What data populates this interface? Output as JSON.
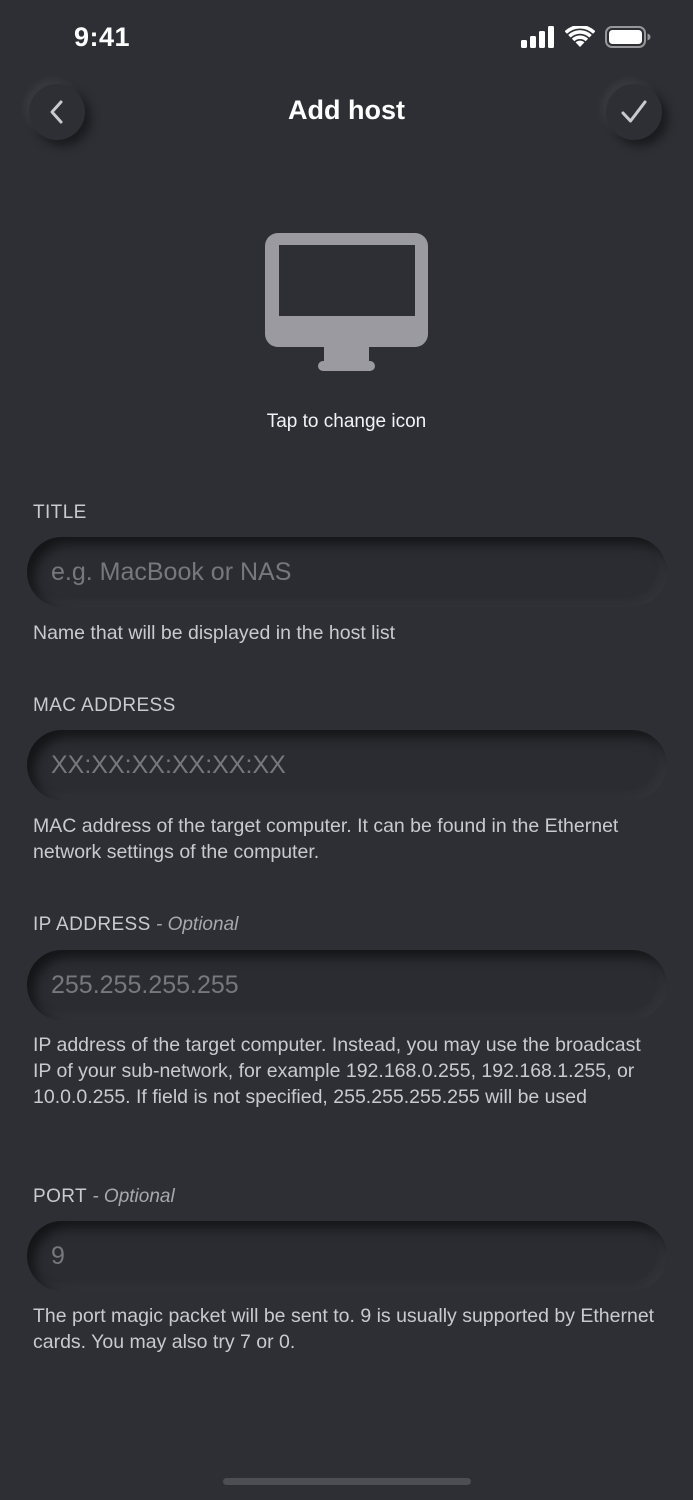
{
  "status_bar": {
    "time": "9:41",
    "icons": [
      "cellular-signal-icon",
      "wifi-icon",
      "battery-icon"
    ]
  },
  "nav": {
    "title": "Add host",
    "back_icon": "chevron-left-icon",
    "done_icon": "checkmark-icon"
  },
  "host_icon": {
    "icon": "desktop-computer-icon",
    "label": "Tap to change icon"
  },
  "fields": {
    "title": {
      "label": "TITLE",
      "optional": "",
      "value": "",
      "placeholder": "e.g. MacBook or NAS",
      "help": "Name that will be displayed in the host list"
    },
    "mac": {
      "label": "MAC ADDRESS",
      "optional": "",
      "value": "",
      "placeholder": "XX:XX:XX:XX:XX:XX",
      "help": "MAC address of the target computer. It can be found in the Ethernet network settings of the computer."
    },
    "ip": {
      "label": "IP ADDRESS",
      "optional": " - Optional",
      "value": "",
      "placeholder": "255.255.255.255",
      "help": "IP address of the target computer. Instead, you may use the broadcast IP of your sub-network, for example 192.168.0.255, 192.168.1.255, or 10.0.0.255. If field is not specified, 255.255.255.255 will be used"
    },
    "port": {
      "label": "PORT",
      "optional": " - Optional",
      "value": "",
      "placeholder": "9",
      "help": "The port magic packet will be sent to. 9 is usually supported by Ethernet cards. You may also try 7 or 0."
    }
  },
  "colors": {
    "background": "#2e2f34",
    "text": "#e9e9ee",
    "muted_text": "#c9c9cf",
    "placeholder": "#77777d",
    "icon_gray": "#9a9aa0"
  }
}
